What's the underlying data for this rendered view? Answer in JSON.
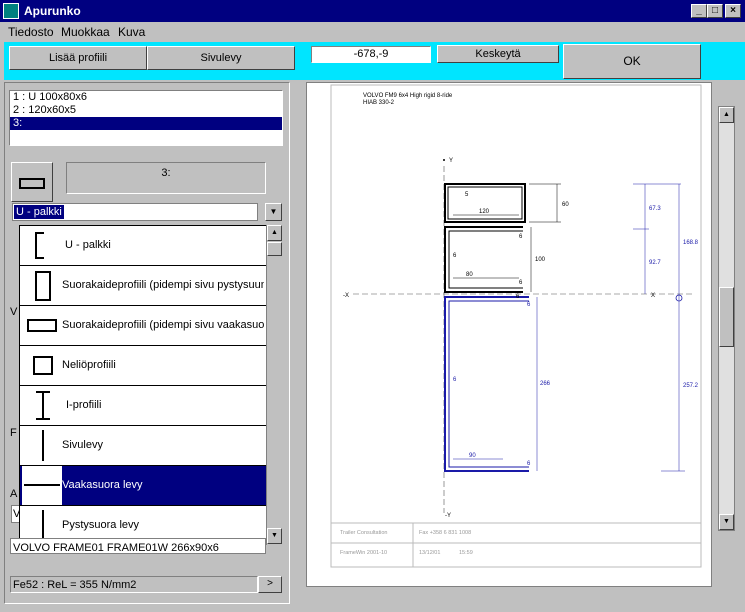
{
  "window": {
    "title": "Apurunko"
  },
  "menu": {
    "items": [
      "Tiedosto",
      "Muokkaa",
      "Kuva"
    ]
  },
  "toolbar": {
    "add_profile": "Lisää profiili",
    "side_plate": "Sivulevy",
    "coord_value": "-678,-9",
    "cancel": "Keskeytä",
    "ok": "OK"
  },
  "profiles": {
    "items": [
      "1 : U 100x80x6",
      "2 : 120x60x5",
      "3:"
    ],
    "selected_index": 2
  },
  "current": {
    "label": "3:",
    "type_selected": "U - palkki"
  },
  "profile_types": [
    "U - palkki",
    "Suorakaideprofiili (pidempi sivu pystysuunta",
    "Suorakaideprofiili (pidempi sivu vaakasuora",
    "Neliöprofiili",
    "I-profiili",
    "Sivulevy",
    "Vaakasuora levy",
    "Pystysuora levy"
  ],
  "profile_types_selected": 6,
  "bottom": {
    "vehicle_text": "VOLVO FRAME01 FRAME01W 266x90x6",
    "material": "Fe52 : ReL = 355 N/mm2",
    "hidden_letters": [
      "V",
      "F",
      "A",
      "V"
    ]
  },
  "drawing": {
    "header_line1": "VOLVO FM9 6x4 High rigid 8-ride",
    "header_line2": "HIAB 330-2",
    "y_axis": "Y",
    "x_axis": "X",
    "neg_y": "-Y",
    "neg_x": "-X",
    "dims": {
      "d5": "5",
      "d120": "120",
      "d60": "60",
      "d6a": "6",
      "d6b": "6",
      "d100": "100",
      "d80": "80",
      "d6c": "6",
      "d6d": "6",
      "d266": "266",
      "d90": "90",
      "d6e": "6",
      "d6f": "6",
      "d6g": "6",
      "r67_3": "67.3",
      "r92_7": "92.7",
      "r168_8": "168.8",
      "r257_2": "257.2"
    },
    "footer_left1": "Trailer Consultation",
    "footer_right1": "Fax +358 6 831 1008",
    "footer_left2": "FrameWin 2001-10",
    "footer_mid2": "13/12/01",
    "footer_right2": "15:59"
  },
  "colors": {
    "accent": "#000080",
    "toolbar_bg": "#00e5ff",
    "drawing_blue": "#1a1aa8"
  }
}
